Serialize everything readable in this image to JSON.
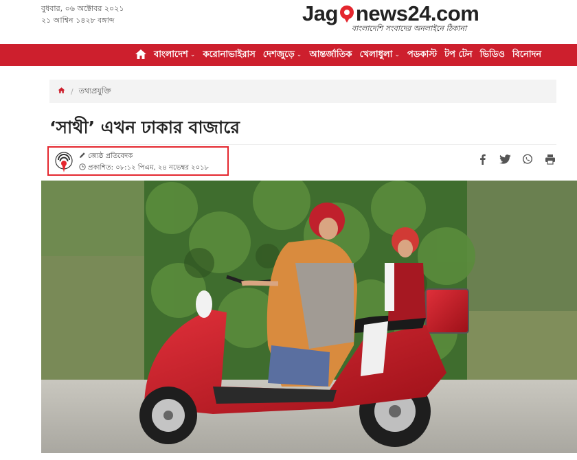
{
  "header": {
    "date_line_1": "বুধবার, ০৬ অক্টোবর ২০২১",
    "date_line_2": "২১ আশ্বিন ১৪২৮ বঙ্গাব্দ",
    "logo_text_prefix": "Jag",
    "logo_text_suffix": "news24.com",
    "logo_tagline": "বাংলাদেশি সংবাদের অনলাইনে ঠিকানা"
  },
  "nav": {
    "home_icon": "home-icon",
    "items": [
      {
        "label": "বাংলাদেশ",
        "has_dropdown": true
      },
      {
        "label": "করোনাভাইরাস",
        "has_dropdown": false
      },
      {
        "label": "দেশজুড়ে",
        "has_dropdown": true
      },
      {
        "label": "আন্তর্জাতিক",
        "has_dropdown": false
      },
      {
        "label": "খেলাধুলা",
        "has_dropdown": true
      },
      {
        "label": "পডকাস্ট",
        "has_dropdown": false
      },
      {
        "label": "টপ টেন",
        "has_dropdown": false
      },
      {
        "label": "ভিডিও",
        "has_dropdown": false
      },
      {
        "label": "বিনোদন",
        "has_dropdown": false
      }
    ],
    "caret": "⌄"
  },
  "breadcrumb": {
    "separator": "/",
    "category": "তথ্যপ্রযুক্তি"
  },
  "article": {
    "title": "‘সাথী’ এখন ঢাকার বাজারে",
    "author": "জ্যেষ্ঠ প্রতিবেদক",
    "published": "প্রকাশিত: ০৮:১২ পিএম, ২৪ নভেম্বর ২০১৮"
  },
  "share": [
    "facebook-icon",
    "twitter-icon",
    "whatsapp-icon",
    "print-icon"
  ],
  "colors": {
    "brand_red": "#cd1f2d",
    "highlight_box": "#e4262e",
    "breadcrumb_bg": "#f3f3f3"
  }
}
